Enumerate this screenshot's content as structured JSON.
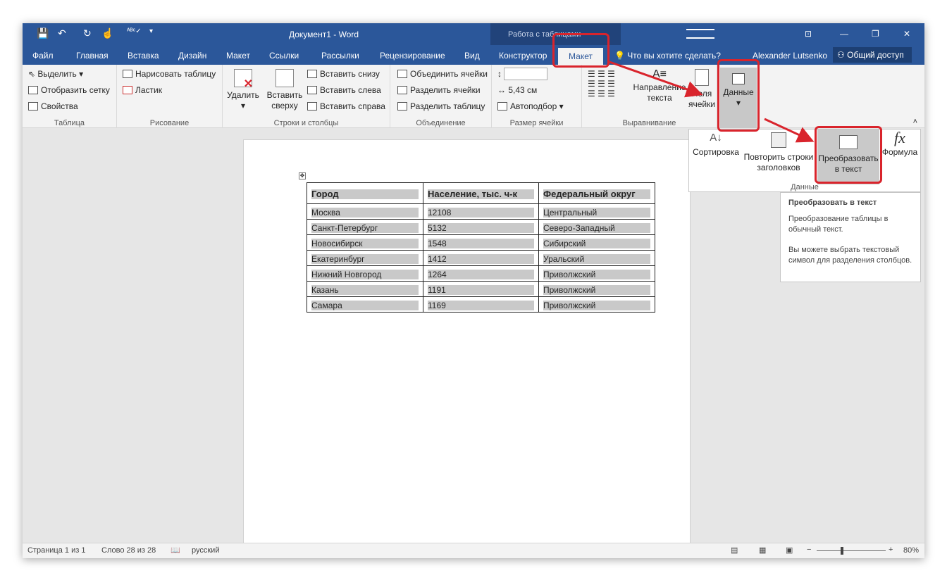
{
  "title": "Документ1 - Word",
  "context_title": "Работа с таблицами",
  "user": "Alexander Lutsenko",
  "share": "Общий доступ",
  "tell_me": "Что вы хотите сделать?",
  "tabs": [
    "Файл",
    "Главная",
    "Вставка",
    "Дизайн",
    "Макет",
    "Ссылки",
    "Рассылки",
    "Рецензирование",
    "Вид",
    "Конструктор",
    "Макет"
  ],
  "ribbon": {
    "table": {
      "select": "Выделить",
      "grid": "Отобразить сетку",
      "props": "Свойства",
      "label": "Таблица"
    },
    "draw": {
      "draw": "Нарисовать таблицу",
      "eraser": "Ластик",
      "label": "Рисование"
    },
    "rows": {
      "delete": "Удалить",
      "insert_above_1": "Вставить",
      "insert_above_2": "сверху",
      "below": "Вставить снизу",
      "left": "Вставить слева",
      "right": "Вставить справа",
      "label": "Строки и столбцы"
    },
    "merge": {
      "merge": "Объединить ячейки",
      "split": "Разделить ячейки",
      "split_table": "Разделить таблицу",
      "label": "Объединение"
    },
    "size": {
      "width": "5,43 см",
      "autofit": "Автоподбор",
      "label": "Размер ячейки"
    },
    "align": {
      "dir1": "Направление",
      "dir2": "текста",
      "margins1": "Поля",
      "margins2": "ячейки",
      "label": "Выравнивание"
    },
    "data": {
      "label": "Данные"
    }
  },
  "dropdown": {
    "sort": "Сортировка",
    "repeat1": "Повторить строки",
    "repeat2": "заголовков",
    "convert1": "Преобразовать",
    "convert2": "в текст",
    "formula": "Формула",
    "label": "Данные"
  },
  "tooltip": {
    "title": "Преобразовать в текст",
    "p1": "Преобразование таблицы в обычный текст.",
    "p2": "Вы можете выбрать текстовый символ для разделения столбцов."
  },
  "table": {
    "headers": [
      "Город",
      "Население, тыс. ч-к",
      "Федеральный округ"
    ],
    "rows": [
      [
        "Москва",
        "12108",
        "Центральный"
      ],
      [
        "Санкт-Петербург",
        "5132",
        "Северо-Западный"
      ],
      [
        "Новосибирск",
        "1548",
        "Сибирский"
      ],
      [
        "Екатеринбург",
        "1412",
        "Уральский"
      ],
      [
        "Нижний Новгород",
        "1264",
        "Приволжский"
      ],
      [
        "Казань",
        "1191",
        "Приволжский"
      ],
      [
        "Самара",
        "1169",
        "Приволжский"
      ]
    ]
  },
  "status": {
    "page": "Страница 1 из 1",
    "words": "Слово 28 из 28",
    "lang": "русский",
    "zoom": "80%"
  },
  "colors": {
    "accent": "#2b579a",
    "highlight": "#d9242c"
  }
}
